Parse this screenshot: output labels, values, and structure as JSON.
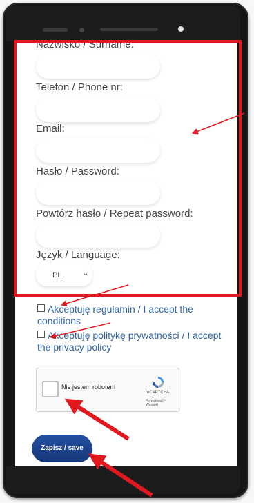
{
  "form": {
    "fields": [
      {
        "label": "Nazwisko / Surname:",
        "value": ""
      },
      {
        "label": "Telefon / Phone nr:",
        "value": ""
      },
      {
        "label": "Email:",
        "value": ""
      },
      {
        "label": "Hasło / Password:",
        "value": ""
      },
      {
        "label": "Powtórz hasło / Repeat password:",
        "value": ""
      }
    ],
    "language_label": "Język / Language:",
    "language_value": "PL",
    "terms_checkbox": "Akceptuję regulamin / I accept the conditions",
    "privacy_checkbox": "Akceptuję politykę prywatności / I accept the privacy policy",
    "save_label": "Zapisz / save"
  },
  "recaptcha": {
    "label": "Nie jestem robotem",
    "brand": "reCAPTCHA",
    "links": "Prywatność - Warunki"
  },
  "colors": {
    "highlight": "#e0191f",
    "link": "#2f64a6",
    "button": "#1c3f8c"
  }
}
